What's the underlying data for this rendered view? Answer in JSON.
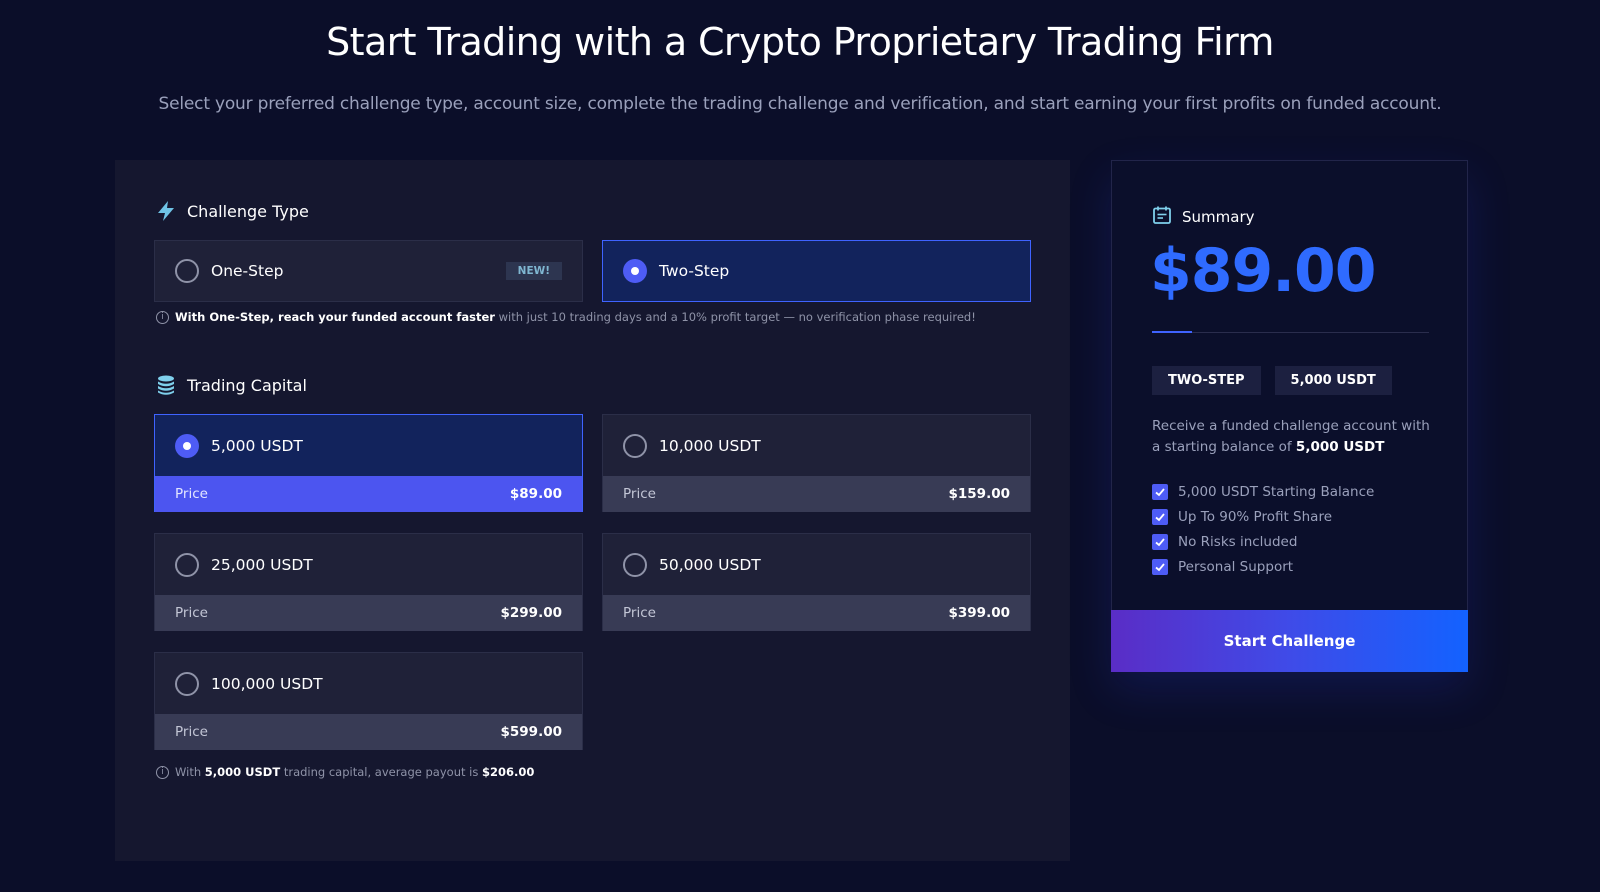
{
  "header": {
    "title": "Start Trading with a Crypto Proprietary Trading Firm",
    "subtitle": "Select your preferred challenge type, account size, complete the trading challenge and verification, and start earning your first profits on funded account."
  },
  "challenge": {
    "heading": "Challenge Type",
    "icon": "lightning-icon",
    "options": [
      {
        "label": "One-Step",
        "badge": "NEW!",
        "selected": false
      },
      {
        "label": "Two-Step",
        "selected": true
      }
    ],
    "note_bold": "With One-Step, reach your funded account faster",
    "note_rest": " with just 10 trading days and a 10% profit target — no verification phase required!"
  },
  "capital": {
    "heading": "Trading Capital",
    "icon": "coins-stack-icon",
    "price_label": "Price",
    "options": [
      {
        "label": "5,000 USDT",
        "price": "$89.00",
        "selected": true
      },
      {
        "label": "10,000 USDT",
        "price": "$159.00",
        "selected": false
      },
      {
        "label": "25,000 USDT",
        "price": "$299.00",
        "selected": false
      },
      {
        "label": "50,000 USDT",
        "price": "$399.00",
        "selected": false
      },
      {
        "label": "100,000 USDT",
        "price": "$599.00",
        "selected": false
      }
    ],
    "note_pre": "With ",
    "note_capital": "5,000 USDT",
    "note_mid": " trading capital, average payout is ",
    "note_payout": "$206.00"
  },
  "summary": {
    "heading": "Summary",
    "icon": "calendar-icon",
    "price": "$89.00",
    "chips": [
      "TWO-STEP",
      "5,000 USDT"
    ],
    "desc_pre": "Receive a funded challenge account with a starting balance of ",
    "desc_bold": "5,000 USDT",
    "features": [
      "5,000 USDT Starting Balance",
      "Up To 90% Profit Share",
      "No Risks included",
      "Personal Support"
    ],
    "button": "Start Challenge"
  },
  "colors": {
    "background": "#0b0e29",
    "panel": "#15172f",
    "accent": "#4e5cf5",
    "price_blue": "#2f6bff"
  }
}
